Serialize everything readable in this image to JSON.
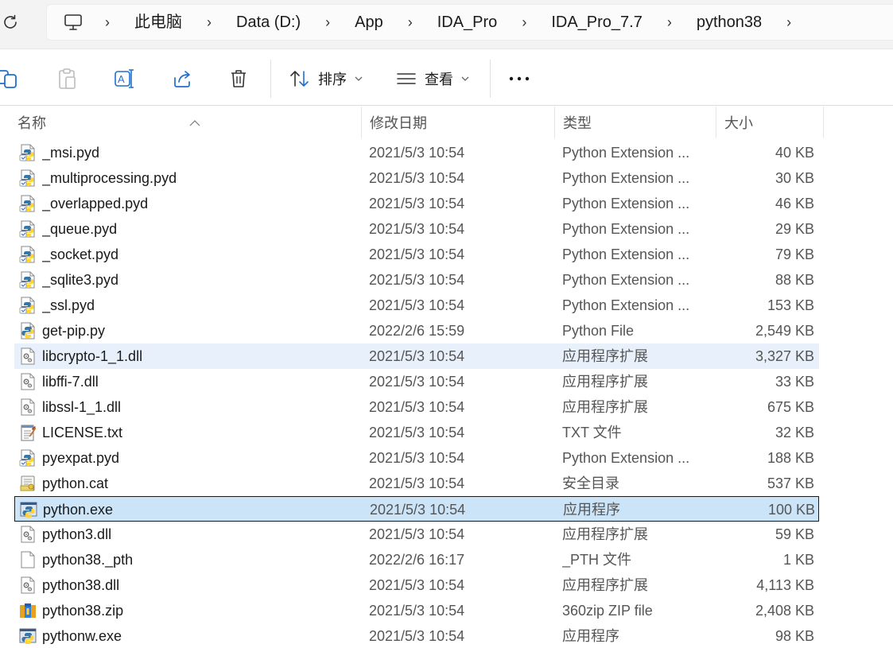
{
  "breadcrumb": [
    "此电脑",
    "Data (D:)",
    "App",
    "IDA_Pro",
    "IDA_Pro_7.7",
    "python38"
  ],
  "toolbar": {
    "sort_label": "排序",
    "view_label": "查看"
  },
  "columns": {
    "name": "名称",
    "date": "修改日期",
    "type": "类型",
    "size": "大小"
  },
  "files": [
    {
      "name": "_msi.pyd",
      "date": "2021/5/3 10:54",
      "type": "Python Extension ...",
      "size": "40 KB",
      "icon": "python-ext-icon"
    },
    {
      "name": "_multiprocessing.pyd",
      "date": "2021/5/3 10:54",
      "type": "Python Extension ...",
      "size": "30 KB",
      "icon": "python-ext-icon"
    },
    {
      "name": "_overlapped.pyd",
      "date": "2021/5/3 10:54",
      "type": "Python Extension ...",
      "size": "46 KB",
      "icon": "python-ext-icon"
    },
    {
      "name": "_queue.pyd",
      "date": "2021/5/3 10:54",
      "type": "Python Extension ...",
      "size": "29 KB",
      "icon": "python-ext-icon"
    },
    {
      "name": "_socket.pyd",
      "date": "2021/5/3 10:54",
      "type": "Python Extension ...",
      "size": "79 KB",
      "icon": "python-ext-icon"
    },
    {
      "name": "_sqlite3.pyd",
      "date": "2021/5/3 10:54",
      "type": "Python Extension ...",
      "size": "88 KB",
      "icon": "python-ext-icon"
    },
    {
      "name": "_ssl.pyd",
      "date": "2021/5/3 10:54",
      "type": "Python Extension ...",
      "size": "153 KB",
      "icon": "python-ext-icon"
    },
    {
      "name": "get-pip.py",
      "date": "2022/2/6 15:59",
      "type": "Python File",
      "size": "2,549 KB",
      "icon": "python-file-icon"
    },
    {
      "name": "libcrypto-1_1.dll",
      "date": "2021/5/3 10:54",
      "type": "应用程序扩展",
      "size": "3,327 KB",
      "icon": "dll-icon",
      "state": "hover"
    },
    {
      "name": "libffi-7.dll",
      "date": "2021/5/3 10:54",
      "type": "应用程序扩展",
      "size": "33 KB",
      "icon": "dll-icon"
    },
    {
      "name": "libssl-1_1.dll",
      "date": "2021/5/3 10:54",
      "type": "应用程序扩展",
      "size": "675 KB",
      "icon": "dll-icon"
    },
    {
      "name": "LICENSE.txt",
      "date": "2021/5/3 10:54",
      "type": "TXT 文件",
      "size": "32 KB",
      "icon": "text-file-icon"
    },
    {
      "name": "pyexpat.pyd",
      "date": "2021/5/3 10:54",
      "type": "Python Extension ...",
      "size": "188 KB",
      "icon": "python-ext-icon"
    },
    {
      "name": "python.cat",
      "date": "2021/5/3 10:54",
      "type": "安全目录",
      "size": "537 KB",
      "icon": "security-catalog-icon"
    },
    {
      "name": "python.exe",
      "date": "2021/5/3 10:54",
      "type": "应用程序",
      "size": "100 KB",
      "icon": "python-exe-icon",
      "state": "selected"
    },
    {
      "name": "python3.dll",
      "date": "2021/5/3 10:54",
      "type": "应用程序扩展",
      "size": "59 KB",
      "icon": "dll-icon"
    },
    {
      "name": "python38._pth",
      "date": "2022/2/6 16:17",
      "type": "_PTH 文件",
      "size": "1 KB",
      "icon": "blank-file-icon"
    },
    {
      "name": "python38.dll",
      "date": "2021/5/3 10:54",
      "type": "应用程序扩展",
      "size": "4,113 KB",
      "icon": "dll-icon"
    },
    {
      "name": "python38.zip",
      "date": "2021/5/3 10:54",
      "type": "360zip ZIP file",
      "size": "2,408 KB",
      "icon": "zip-archive-icon"
    },
    {
      "name": "pythonw.exe",
      "date": "2021/5/3 10:54",
      "type": "应用程序",
      "size": "98 KB",
      "icon": "python-exe-icon"
    }
  ],
  "colors": {
    "hover_row": "#e8f1fb",
    "selected_row": "#cce4f7",
    "python_blue": "#3776ab",
    "python_yellow": "#ffd43b"
  }
}
